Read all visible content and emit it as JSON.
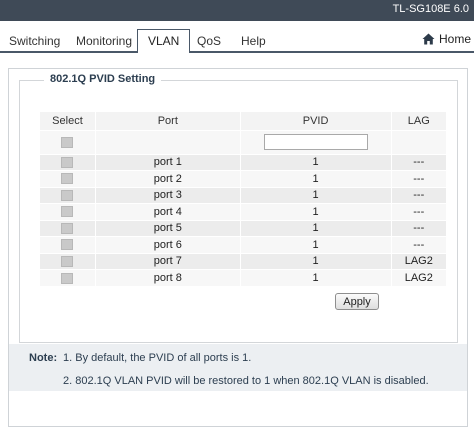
{
  "header": {
    "model": "TL-SG108E 6.0"
  },
  "nav": {
    "tabs": [
      "Switching",
      "Monitoring",
      "VLAN",
      "QoS",
      "Help"
    ],
    "active": "VLAN",
    "home_label": "Home"
  },
  "section": {
    "title": "802.1Q PVID Setting"
  },
  "table": {
    "columns": [
      "Select",
      "Port",
      "PVID",
      "LAG"
    ],
    "filter_pvid_value": "",
    "rows": [
      {
        "port": "port 1",
        "pvid": "1",
        "lag": "---"
      },
      {
        "port": "port 2",
        "pvid": "1",
        "lag": "---"
      },
      {
        "port": "port 3",
        "pvid": "1",
        "lag": "---"
      },
      {
        "port": "port 4",
        "pvid": "1",
        "lag": "---"
      },
      {
        "port": "port 5",
        "pvid": "1",
        "lag": "---"
      },
      {
        "port": "port 6",
        "pvid": "1",
        "lag": "---"
      },
      {
        "port": "port 7",
        "pvid": "1",
        "lag": "LAG2"
      },
      {
        "port": "port 8",
        "pvid": "1",
        "lag": "LAG2"
      }
    ]
  },
  "actions": {
    "apply_label": "Apply"
  },
  "notes": {
    "label": "Note:",
    "items": [
      "1. By default, the PVID of all ports is 1.",
      "2. 802.1Q VLAN PVID will be restored to 1 when 802.1Q VLAN is disabled."
    ]
  },
  "colors": {
    "topbar": "#3f4a57",
    "nav_border": "#4a5868",
    "note_bg": "#eceff2"
  }
}
